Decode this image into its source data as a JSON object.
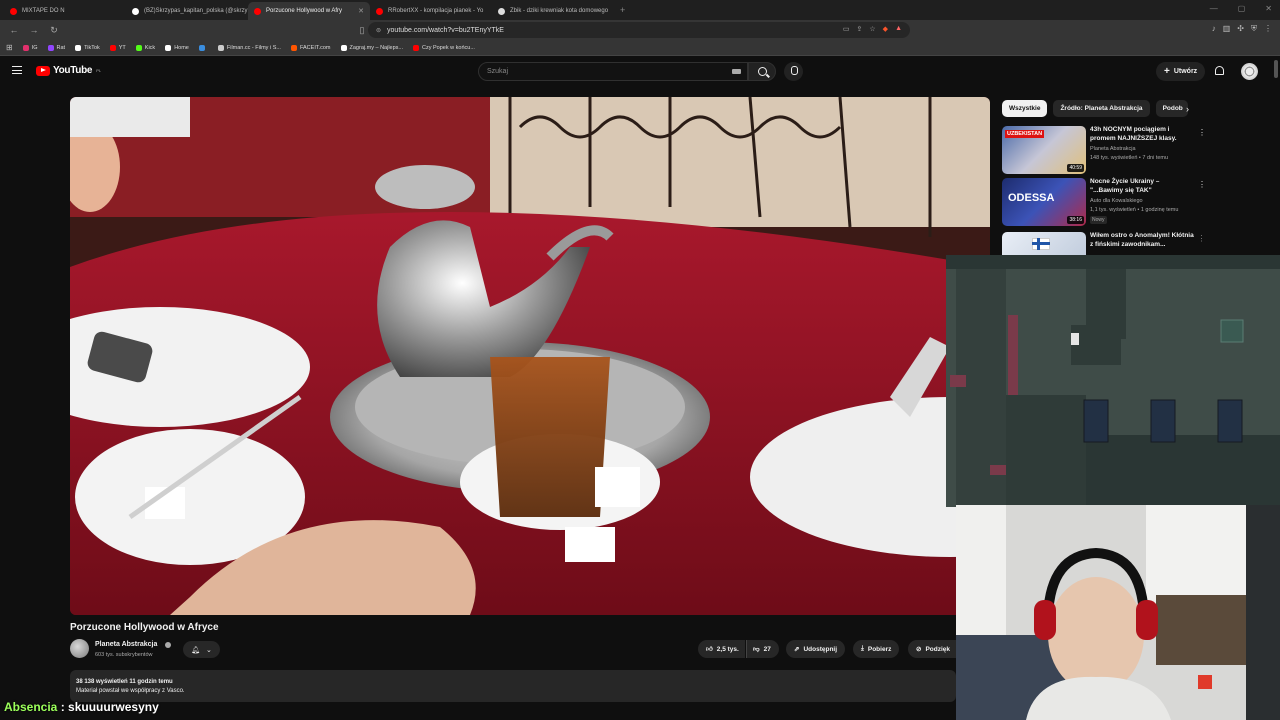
{
  "browser": {
    "tabs": [
      {
        "label": "MIXTAPE DO N",
        "color": "#ff0000",
        "active": false
      },
      {
        "label": "(BZ)Skrzypas_kapitan_polska (@skrzy",
        "color": "#ffffff",
        "active": false
      },
      {
        "label": "Porzucone Hollywood w Afry",
        "color": "#ff0000",
        "active": true
      },
      {
        "label": "RRobertXX - kompilacja pianek - Yo",
        "color": "#ff0000",
        "active": false
      },
      {
        "label": "Zbik - dziki krewniak kota domowego",
        "color": "#dddddd",
        "active": false
      }
    ],
    "new_tab": "+",
    "url": "youtube.com/watch?v=bu2TEnyYTkE",
    "bookmarks": [
      {
        "label": "IG",
        "color": "#e1306c"
      },
      {
        "label": "Rat",
        "color": "#9146ff"
      },
      {
        "label": "TikTok",
        "color": "#ffffff"
      },
      {
        "label": "YT",
        "color": "#ff0000"
      },
      {
        "label": "Kick",
        "color": "#53fc18"
      },
      {
        "label": "Home",
        "color": "#ffffff"
      },
      {
        "label": "",
        "color": "#3a8dde"
      },
      {
        "label": "Filman.cc - Filmy i S...",
        "color": "#cccccc"
      },
      {
        "label": "FACEIT.com",
        "color": "#ff5500"
      },
      {
        "label": "Zagraj.my – Najleps...",
        "color": "#ffffff"
      },
      {
        "label": "Czy Popek w końcu...",
        "color": "#ff0000"
      }
    ]
  },
  "header": {
    "logo_text": "YouTube",
    "logo_region": "PL",
    "search_placeholder": "Szukaj",
    "create_label": "Utwórz"
  },
  "video": {
    "title": "Porzucone Hollywood w Afryce",
    "channel": "Planeta Abstrakcja",
    "subscribers": "603 tys. subskrybentów",
    "likes": "2,5 tys.",
    "dislikes": "27",
    "share_label": "Udostępnij",
    "download_label": "Pobierz",
    "thanks_label": "Podzięk",
    "views_date": "38 138 wyświetleń  11 godzin temu",
    "description": "Materiał powstał we współpracy z Vasco."
  },
  "sidebar": {
    "chips": [
      "Wszystkie",
      "Źródło: Planeta Abstrakcja",
      "Podob"
    ],
    "recommendations": [
      {
        "title": "43h NOCNYM pociągiem i promem NAJNIŻSZEJ klasy.",
        "channel": "Planeta Abstrakcja",
        "meta": "148 tys. wyświetleń • 7 dni temu",
        "duration": "40:59",
        "thumb_text": "UZBEKISTAN",
        "badge": ""
      },
      {
        "title": "Nocne Życie Ukrainy – \"...Bawimy się TAK\"",
        "channel": "Auto dla Kowalskiego",
        "meta": "1,1 tys. wyświetleń • 1 godzinę temu",
        "duration": "38:16",
        "thumb_text": "ODESSA",
        "badge": "Nowy"
      },
      {
        "title": "Wiłem ostro o Anomalym! Kłótnia z fińskimi zawodnikam...",
        "channel": "",
        "meta": "",
        "duration": "",
        "thumb_text": "",
        "badge": ""
      }
    ]
  },
  "chat": {
    "user": "Absencia",
    "message": "skuuuurwesyny"
  }
}
